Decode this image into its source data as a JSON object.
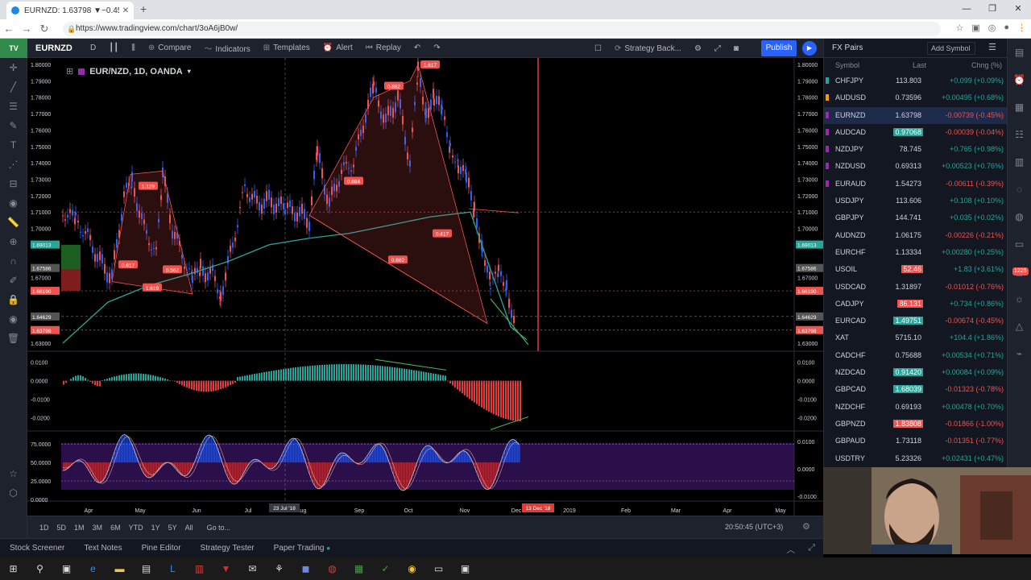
{
  "browser": {
    "tab_title": "EURNZD: 1.63798 ▼−0.45% — Si",
    "url": "https://www.tradingview.com/chart/3oA6jB0w/"
  },
  "toolbar": {
    "symbol": "EURNZD",
    "interval": "D",
    "compare": "Compare",
    "indicators": "Indicators",
    "templates": "Templates",
    "alert": "Alert",
    "replay": "Replay",
    "strategy": "Strategy Back...",
    "publish": "Publish"
  },
  "chart": {
    "legend_title": "EUR/NZD, 1D, OANDA",
    "price_ticks": [
      "1.80000",
      "1.79000",
      "1.78000",
      "1.77000",
      "1.76000",
      "1.75000",
      "1.74000",
      "1.73000",
      "1.72000",
      "1.71000",
      "1.70000",
      "1.69013",
      "1.67586",
      "1.67000",
      "1.66190",
      "1.64629",
      "1.63798",
      "1.63000"
    ],
    "osc1_ticks": [
      "0.0100",
      "0.0000",
      "-0.0100",
      "-0.0200"
    ],
    "osc2_left_ticks": [
      "75.0000",
      "50.0000",
      "25.0000",
      "0.0000"
    ],
    "osc2_right_ticks": [
      "0.0100",
      "0.0000",
      "-0.0100"
    ],
    "time_labels": [
      "Apr",
      "May",
      "Jun",
      "Jul",
      "Aug",
      "Sep",
      "Oct",
      "Nov",
      "Dec",
      "2019",
      "Feb",
      "Mar",
      "Apr",
      "May"
    ],
    "crosshair_date": "23 Jul '18",
    "crosshair_price": "1.64629",
    "marker_date": "13 Dec '18",
    "pattern_labels": [
      "1.129",
      "0.884",
      "0.417",
      "0.862",
      "0.617",
      "0.562",
      "1.619",
      "0.882",
      "1.617"
    ],
    "legend_color": "#9c27b0"
  },
  "rangebar": {
    "ranges": [
      "1D",
      "5D",
      "1M",
      "3M",
      "6M",
      "YTD",
      "1Y",
      "5Y",
      "All"
    ],
    "goto": "Go to...",
    "clock": "20:50:45 (UTC+3)"
  },
  "bottompanel": {
    "tabs": [
      "Stock Screener",
      "Text Notes",
      "Pine Editor",
      "Strategy Tester",
      "Paper Trading"
    ]
  },
  "watchlist": {
    "title": "FX Pairs",
    "add_symbol": "Add Symbol",
    "col_symbol": "Symbol",
    "col_last": "Last",
    "col_change": "Chng (%)",
    "rows": [
      {
        "symbol": "CHFJPY",
        "last": "113.803",
        "change": "+0.099 (+0.09%)",
        "dir": "up",
        "mark": "#26a69a",
        "hl": ""
      },
      {
        "symbol": "AUDUSD",
        "last": "0.73596",
        "change": "+0.00495 (+0.68%)",
        "dir": "up",
        "mark": "#ff9800",
        "hl": ""
      },
      {
        "symbol": "EURNZD",
        "last": "1.63798",
        "change": "-0.00739 (-0.45%)",
        "dir": "dn",
        "mark": "#9c27b0",
        "hl": "",
        "sel": true
      },
      {
        "symbol": "AUDCAD",
        "last": "0.97068",
        "change": "-0.00039 (-0.04%)",
        "dir": "dn",
        "mark": "#9c27b0",
        "hl": "green"
      },
      {
        "symbol": "NZDJPY",
        "last": "78.745",
        "change": "+0.765 (+0.98%)",
        "dir": "up",
        "mark": "#9c27b0",
        "hl": ""
      },
      {
        "symbol": "NZDUSD",
        "last": "0.69313",
        "change": "+0.00523 (+0.76%)",
        "dir": "up",
        "mark": "#9c27b0",
        "hl": ""
      },
      {
        "symbol": "EURAUD",
        "last": "1.54273",
        "change": "-0.00611 (-0.39%)",
        "dir": "dn",
        "mark": "#9c27b0",
        "hl": ""
      },
      {
        "symbol": "USDJPY",
        "last": "113.606",
        "change": "+0.108 (+0.10%)",
        "dir": "up",
        "mark": "",
        "hl": ""
      },
      {
        "symbol": "GBPJPY",
        "last": "144.741",
        "change": "+0.035 (+0.02%)",
        "dir": "up",
        "mark": "",
        "hl": ""
      },
      {
        "symbol": "AUDNZD",
        "last": "1.06175",
        "change": "-0.00226 (-0.21%)",
        "dir": "dn",
        "mark": "",
        "hl": ""
      },
      {
        "symbol": "EURCHF",
        "last": "1.13334",
        "change": "+0.00280 (+0.25%)",
        "dir": "up",
        "mark": "",
        "hl": ""
      },
      {
        "symbol": "USOIL",
        "last": "52.46",
        "change": "+1.83 (+3.61%)",
        "dir": "up",
        "mark": "",
        "hl": "red"
      },
      {
        "symbol": "USDCAD",
        "last": "1.31897",
        "change": "-0.01012 (-0.76%)",
        "dir": "dn",
        "mark": "",
        "hl": ""
      },
      {
        "symbol": "CADJPY",
        "last": "86.131",
        "change": "+0.734 (+0.86%)",
        "dir": "up",
        "mark": "",
        "hl": "red"
      },
      {
        "symbol": "EURCAD",
        "last": "1.49751",
        "change": "-0.00674 (-0.45%)",
        "dir": "dn",
        "mark": "",
        "hl": "green"
      },
      {
        "symbol": "XAT",
        "last": "5715.10",
        "change": "+104.4 (+1.86%)",
        "dir": "up",
        "mark": "",
        "hl": ""
      },
      {
        "symbol": "CADCHF",
        "last": "0.75688",
        "change": "+0.00534 (+0.71%)",
        "dir": "up",
        "mark": "",
        "hl": ""
      },
      {
        "symbol": "NZDCAD",
        "last": "0.91420",
        "change": "+0.00084 (+0.09%)",
        "dir": "up",
        "mark": "",
        "hl": "green"
      },
      {
        "symbol": "GBPCAD",
        "last": "1.68039",
        "change": "-0.01323 (-0.78%)",
        "dir": "dn",
        "mark": "",
        "hl": "green"
      },
      {
        "symbol": "NZDCHF",
        "last": "0.69193",
        "change": "+0.00478 (+0.70%)",
        "dir": "up",
        "mark": "",
        "hl": ""
      },
      {
        "symbol": "GBPNZD",
        "last": "1.83808",
        "change": "-0.01866 (-1.00%)",
        "dir": "dn",
        "mark": "",
        "hl": "red"
      },
      {
        "symbol": "GBPAUD",
        "last": "1.73118",
        "change": "-0.01351 (-0.77%)",
        "dir": "dn",
        "mark": "",
        "hl": ""
      },
      {
        "symbol": "USDTRY",
        "last": "5.23326",
        "change": "+0.02431 (+0.47%)",
        "dir": "up",
        "mark": "",
        "hl": ""
      }
    ]
  },
  "badge_count": "1225"
}
